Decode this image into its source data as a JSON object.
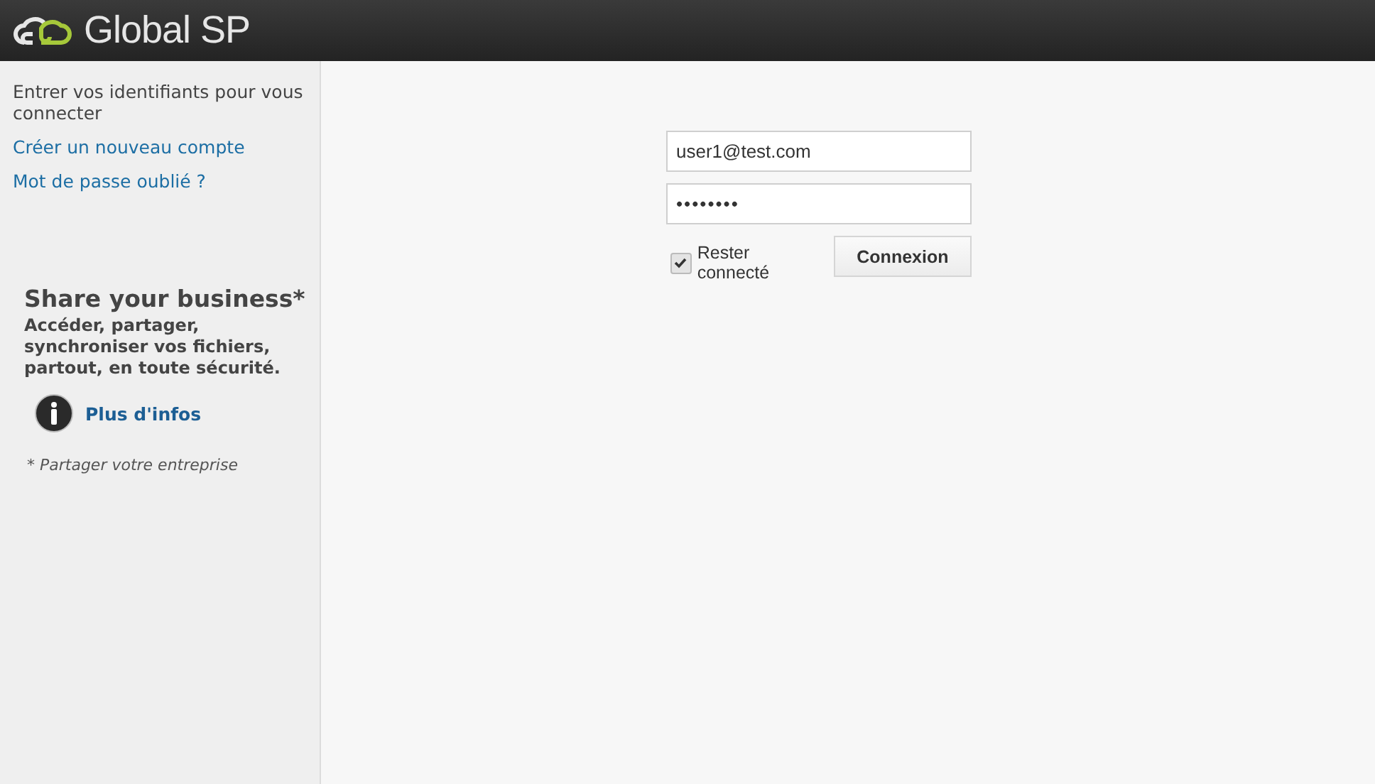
{
  "header": {
    "logo_text": "Global SP"
  },
  "sidebar": {
    "intro": "Entrer vos identifiants pour vous connecter",
    "links": [
      "Créer un nouveau compte",
      "Mot de passe oublié ?"
    ],
    "promo": {
      "title": "Share your business*",
      "text": "Accéder, partager, synchroniser vos fichiers, partout, en toute sécurité.",
      "more_link": "Plus d'infos",
      "footnote": "* Partager votre entreprise"
    }
  },
  "login": {
    "email": {
      "value": "user1@test.com"
    },
    "password": {
      "value": "••••••••"
    },
    "remember": {
      "label": "Rester connecté",
      "checked": true
    },
    "submit": "Connexion"
  }
}
